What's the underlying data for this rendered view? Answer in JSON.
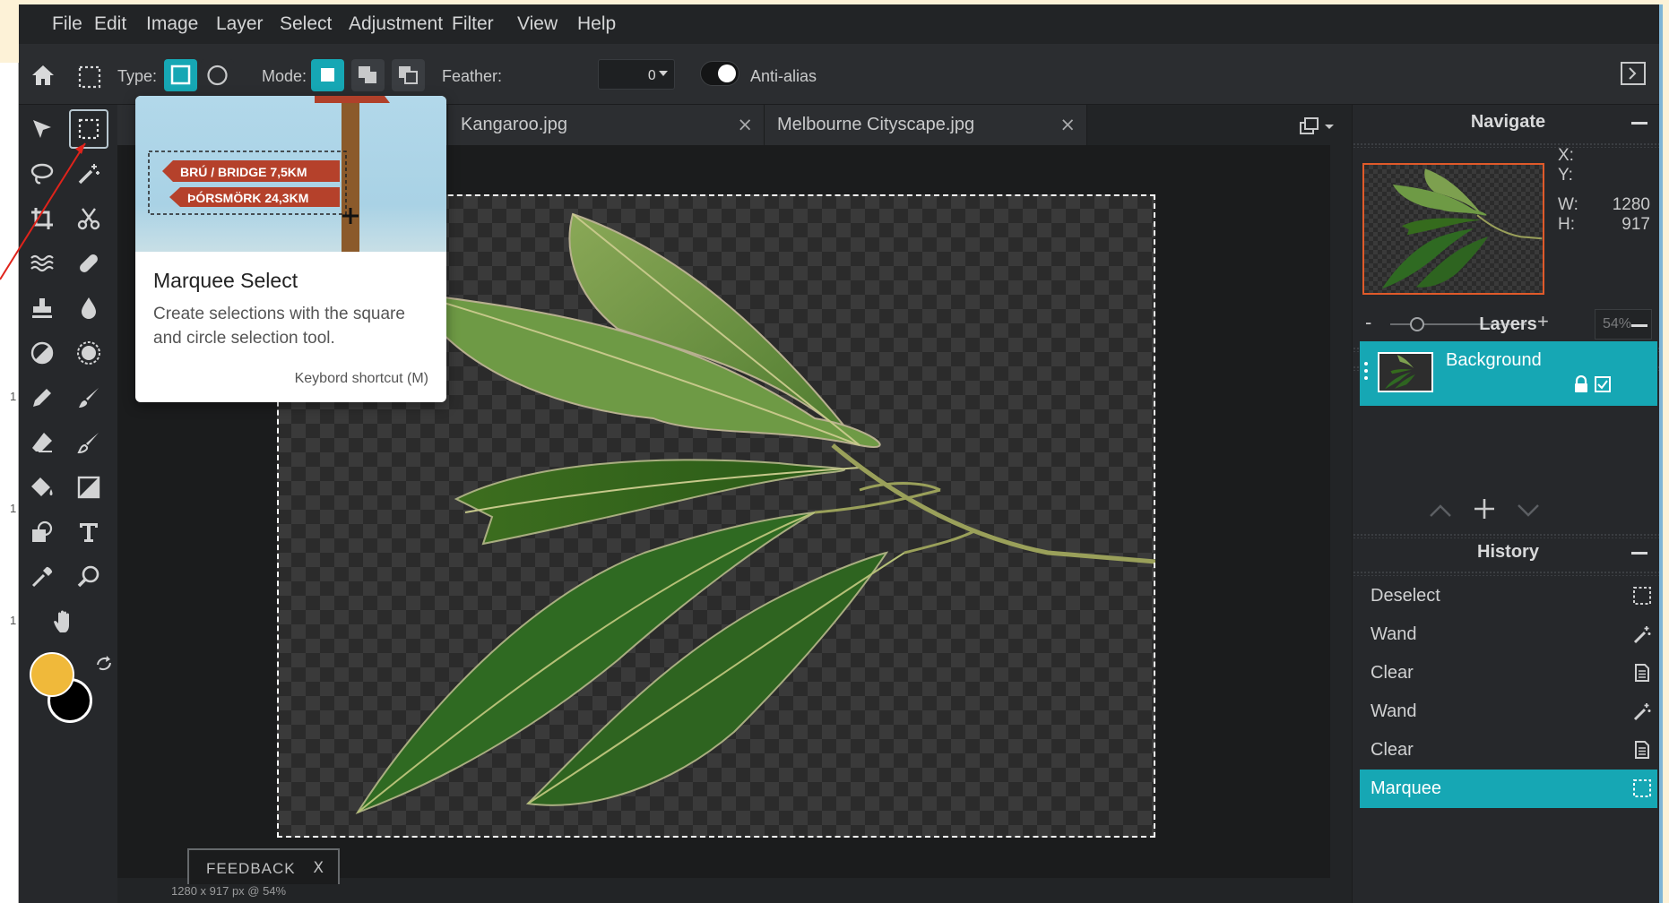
{
  "menu": [
    "File",
    "Edit",
    "Image",
    "Layer",
    "Select",
    "Adjustment",
    "Filter",
    "View",
    "Help"
  ],
  "options": {
    "type_label": "Type:",
    "mode_label": "Mode:",
    "feather_label": "Feather:",
    "feather_value": "0",
    "antialias_label": "Anti-alias"
  },
  "tabs": [
    {
      "label": "Kangaroo.jpg"
    },
    {
      "label": "Melbourne Cityscape.jpg"
    }
  ],
  "tooltip": {
    "title": "Marquee Select",
    "description": "Create selections with the square and circle selection tool.",
    "shortcut": "Keybord shortcut (M)",
    "sign_top": "BRÚ / BRIDGE 7,5KM",
    "sign_bottom": "ÞÓRSMÖRK 24,3KM"
  },
  "status": {
    "text": "1280 x 917 px @ 54%"
  },
  "feedback": {
    "label": "FEEDBACK",
    "close": "X"
  },
  "navigate": {
    "title": "Navigate",
    "x_label": "X:",
    "y_label": "Y:",
    "w_label": "W:",
    "h_label": "H:",
    "w_value": "1280",
    "h_value": "917",
    "zoom_minus": "-",
    "zoom_plus": "+",
    "zoom_percent": "54%",
    "zoom_level": 0.2
  },
  "layers": {
    "title": "Layers",
    "items": [
      {
        "name": "Background"
      }
    ]
  },
  "history": {
    "title": "History",
    "items": [
      {
        "label": "Deselect",
        "icon": "marquee-icon"
      },
      {
        "label": "Wand",
        "icon": "wand-icon"
      },
      {
        "label": "Clear",
        "icon": "document-icon"
      },
      {
        "label": "Wand",
        "icon": "wand-icon"
      },
      {
        "label": "Clear",
        "icon": "document-icon"
      },
      {
        "label": "Marquee",
        "icon": "marquee-icon"
      }
    ]
  },
  "colors": {
    "accent": "#16a7b4",
    "foreground": "#f0b93a",
    "background": "#000000"
  },
  "left_edge_labels": [
    "1",
    "1",
    "1"
  ]
}
